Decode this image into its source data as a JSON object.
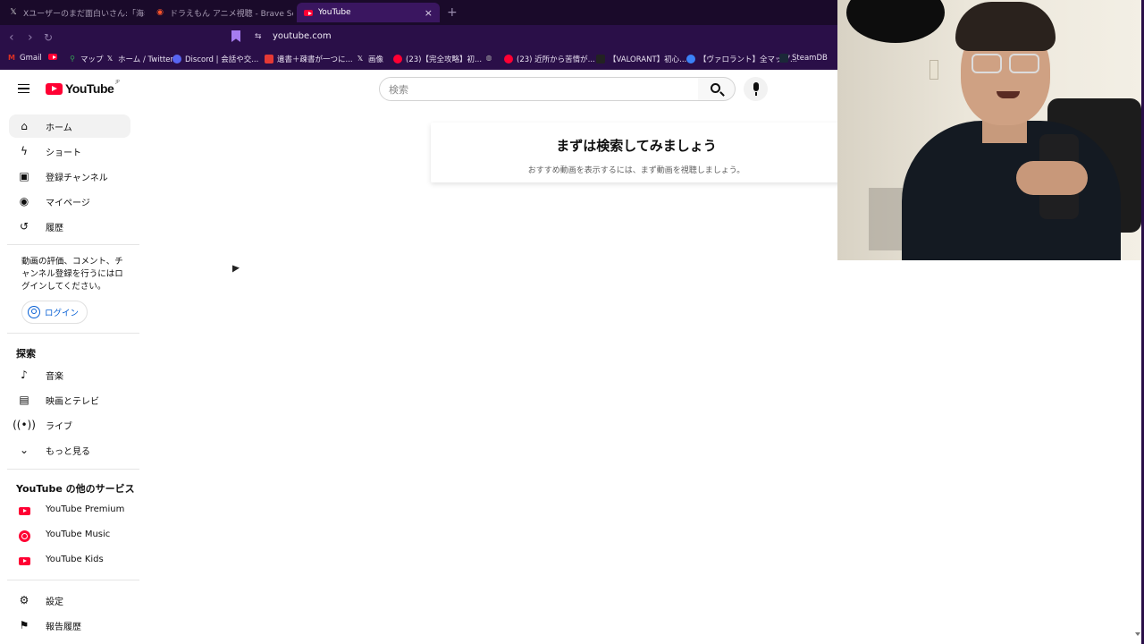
{
  "browser": {
    "tabs": [
      {
        "label": "Xユーザーのまだ面白いさん:「海老蔵がド",
        "icon": "x-logo-icon",
        "active": false
      },
      {
        "label": "ドラえもん アニメ視聴 - Brave Search",
        "icon": "brave-icon",
        "active": false
      },
      {
        "label": "YouTube",
        "icon": "youtube-icon",
        "active": true
      }
    ],
    "new_tab": "+",
    "close_tab": "×",
    "url": "youtube.com",
    "bookmarks": [
      {
        "label": "Gmail",
        "icon": "gmail-icon",
        "color": "#d93025"
      },
      {
        "label": "",
        "icon": "youtube-icon",
        "color": "#ff0033"
      },
      {
        "label": "マップ",
        "icon": "maps-icon",
        "color": "#34a853"
      },
      {
        "label": "ホーム / Twitter",
        "icon": "x-logo-icon",
        "color": "#000000"
      },
      {
        "label": "Discord | 会話や交...",
        "icon": "discord-icon",
        "color": "#5865f2"
      },
      {
        "label": "遺書＋疎書が一つに...",
        "icon": "app-icon",
        "color": "#e53935"
      },
      {
        "label": "画像",
        "icon": "x-logo-icon",
        "color": "#000000"
      },
      {
        "label": "(23)【完全攻略】初...",
        "icon": "youtube-icon",
        "color": "#ff0033"
      },
      {
        "label": "",
        "icon": "globe-icon",
        "color": "#888888"
      },
      {
        "label": "(23) 近所から苦情が...",
        "icon": "youtube-icon",
        "color": "#ff0033"
      },
      {
        "label": "【VALORANT】初心...",
        "icon": "page-icon",
        "color": "#222222"
      },
      {
        "label": "【ヴァロラント】全マップ...",
        "icon": "site-icon",
        "color": "#3b82f6"
      },
      {
        "label": "SteamDB",
        "icon": "steamdb-icon",
        "color": "#1b2838"
      }
    ]
  },
  "youtube": {
    "logo_text": "YouTube",
    "logo_region": "JP",
    "search_placeholder": "検索",
    "nav": [
      {
        "label": "ホーム",
        "icon": "home-icon",
        "selected": true
      },
      {
        "label": "ショート",
        "icon": "shorts-icon",
        "selected": false
      },
      {
        "label": "登録チャンネル",
        "icon": "subscriptions-icon",
        "selected": false
      },
      {
        "label": "マイページ",
        "icon": "account-icon",
        "selected": false
      },
      {
        "label": "履歴",
        "icon": "history-icon",
        "selected": false
      }
    ],
    "signin_prompt": "動画の評価、コメント、チャンネル登録を行うにはログインしてください。",
    "login_label": "ログイン",
    "explore_title": "探索",
    "explore": [
      {
        "label": "音楽",
        "icon": "music-icon"
      },
      {
        "label": "映画とテレビ",
        "icon": "movies-icon"
      },
      {
        "label": "ライブ",
        "icon": "live-icon"
      },
      {
        "label": "もっと見る",
        "icon": "chevron-down-icon"
      }
    ],
    "more_title": "YouTube の他のサービス",
    "more_services": [
      {
        "label": "YouTube Premium",
        "icon": "youtube-premium-icon"
      },
      {
        "label": "YouTube Music",
        "icon": "youtube-music-icon"
      },
      {
        "label": "YouTube Kids",
        "icon": "youtube-kids-icon"
      }
    ],
    "bottom": [
      {
        "label": "設定",
        "icon": "settings-icon"
      },
      {
        "label": "報告履歴",
        "icon": "flag-icon"
      }
    ],
    "empty_title": "まずは検索してみましょう",
    "empty_subtitle": "おすすめ動画を表示するには、まず動画を視聴しましょう。"
  },
  "colors": {
    "brand_red": "#ff0033",
    "link_blue": "#065fd4",
    "browser_bg": "#2a0f48"
  }
}
